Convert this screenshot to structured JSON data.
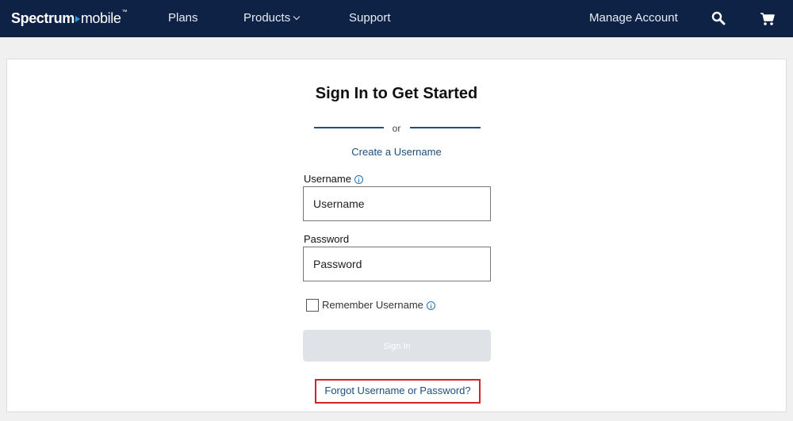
{
  "nav": {
    "brand_bold": "Spectrum",
    "brand_light": "mobile",
    "brand_tm": "™",
    "items": [
      {
        "label": "Plans"
      },
      {
        "label": "Products"
      },
      {
        "label": "Support"
      }
    ],
    "manage_account": "Manage Account",
    "search_icon": "search-icon",
    "cart_icon": "cart-icon"
  },
  "signin": {
    "title": "Sign In to Get Started",
    "or_text": "or",
    "create_link": "Create a Username",
    "username_label": "Username",
    "username_placeholder": "Username",
    "password_label": "Password",
    "password_placeholder": "Password",
    "remember_label": "Remember Username",
    "button_label": "Sign In",
    "forgot_link": "Forgot Username or Password?"
  },
  "colors": {
    "nav_bg": "#0d2245",
    "link": "#1b4f7c",
    "highlight": "#d1232a",
    "button_disabled": "#dfe3e8"
  }
}
